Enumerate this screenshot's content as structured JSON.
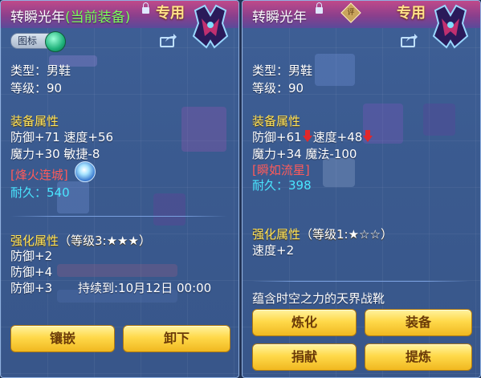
{
  "left": {
    "title": "转瞬光年",
    "equipped_tag": "(当前装备)",
    "exclusive_label": "专用",
    "icon_toggle_label": "图标",
    "type_line": "类型：男鞋",
    "level_line": "等级：90",
    "attr_heading": "装备属性",
    "attr_line1": "防御+71 速度+56",
    "attr_line2": "魔力+30 敏捷-8",
    "skill_name": "[烽火连城]",
    "durability_label": "耐久：",
    "durability_value": "540",
    "enhance_heading": "强化属性",
    "enhance_level": "（等级3:★★★）",
    "enhance_line1": "防御+2",
    "enhance_line2": "防御+4",
    "enhance_line3": "防御+3",
    "duration_text": "持续到:10月12日 00:00",
    "btn_inlay": "镶嵌",
    "btn_unequip": "卸下"
  },
  "right": {
    "title": "转瞬光年",
    "exclusive_label": "专用",
    "badge_glyph": "评",
    "type_line": "类型：男鞋",
    "level_line": "等级：90",
    "attr_heading": "装备属性",
    "attr_def": "防御+61",
    "attr_speed": "速度+48",
    "attr_line2": "魔力+34 魔法-100",
    "skill_name": "[瞬如流星]",
    "durability_label": "耐久：",
    "durability_value": "398",
    "enhance_heading": "强化属性",
    "enhance_level": "（等级1:★☆☆）",
    "enhance_line1": "速度+2",
    "description": "蕴含时空之力的天界战靴",
    "btn_refine": "炼化",
    "btn_equip": "装备",
    "btn_donate": "捐献",
    "btn_extract": "提炼"
  },
  "colors": {
    "panel_bg": "#3a5a8f",
    "title_bar": "#8a3f8c",
    "heading_yellow": "#ffe35a",
    "skill_red": "#ff5a5a",
    "durability_cyan": "#4ae6ff",
    "equipped_green": "#7cff5a",
    "button_gold": "#ffd94a",
    "down_arrow_red": "#e0282a"
  },
  "icons": [
    "lock-icon",
    "share-icon",
    "emblem-icon",
    "rating-badge-icon",
    "skill-orb-icon",
    "down-arrow-icon",
    "toggle-knob-icon"
  ]
}
